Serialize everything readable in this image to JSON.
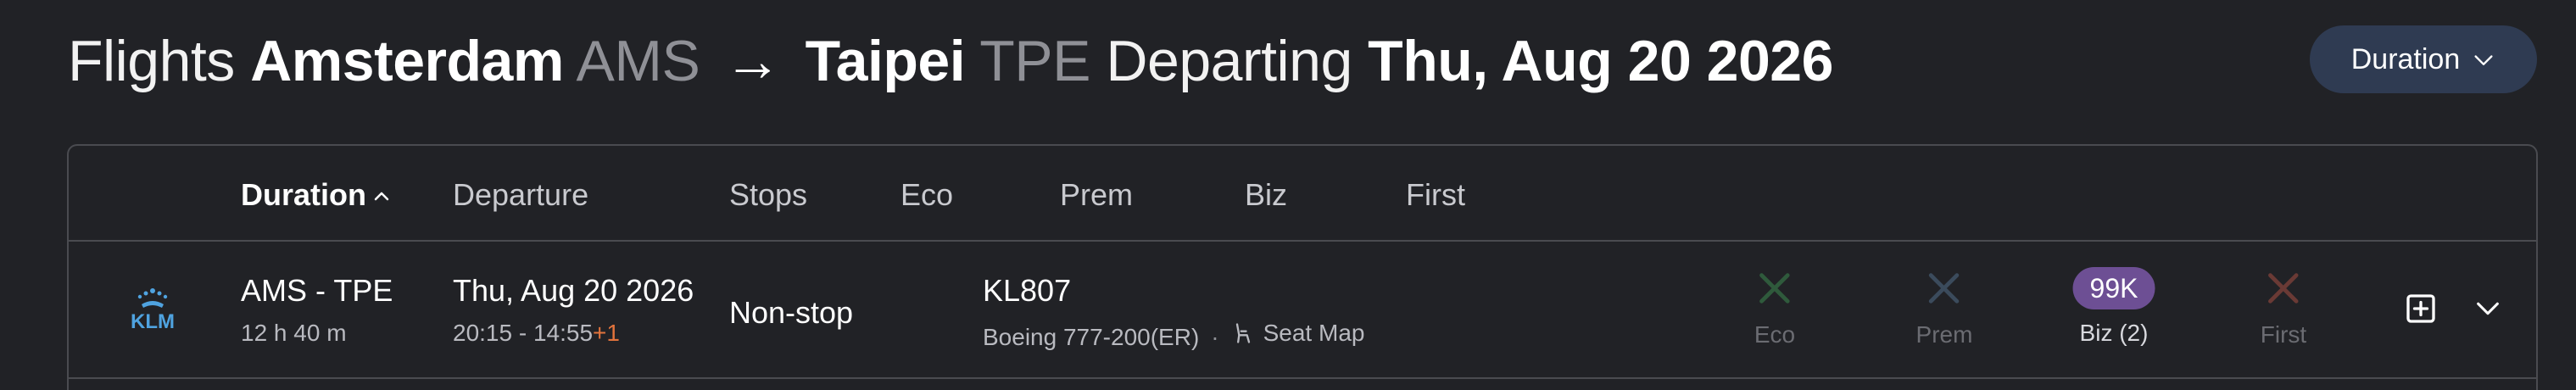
{
  "header": {
    "flights_word": "Flights",
    "origin_city": "Amsterdam",
    "origin_code": "AMS",
    "arrow": "→",
    "dest_city": "Taipei",
    "dest_code": "TPE",
    "departing_word": "Departing",
    "date": "Thu, Aug 20 2026",
    "sort_label": "Duration"
  },
  "columns": {
    "duration": "Duration",
    "departure": "Departure",
    "stops": "Stops",
    "eco": "Eco",
    "prem": "Prem",
    "biz": "Biz",
    "first": "First"
  },
  "flight": {
    "airline_logo_text": "KLM",
    "route": "AMS - TPE",
    "duration": "12 h 40 m",
    "date": "Thu, Aug 20 2026",
    "times": "20:15 - 14:55",
    "day_offset": "+1",
    "stops": "Non-stop",
    "flight_number": "KL807",
    "aircraft": "Boeing 777-200(ER)",
    "separator": "·",
    "seat_map": "Seat Map",
    "cabins": {
      "eco": {
        "label": "Eco",
        "available": false
      },
      "prem": {
        "label": "Prem",
        "available": false
      },
      "biz": {
        "label": "Biz (2)",
        "price": "99K",
        "available": true
      },
      "first": {
        "label": "First",
        "available": false
      }
    }
  },
  "colors": {
    "background": "#212226",
    "sort_button": "#2f3b52",
    "biz_badge": "#6d4f94",
    "eco_x": "#2f5a3c",
    "prem_x": "#3b4b5c",
    "first_x": "#6a3a35",
    "day_offset": "#e2733c",
    "klm_blue": "#4fa3e0"
  }
}
